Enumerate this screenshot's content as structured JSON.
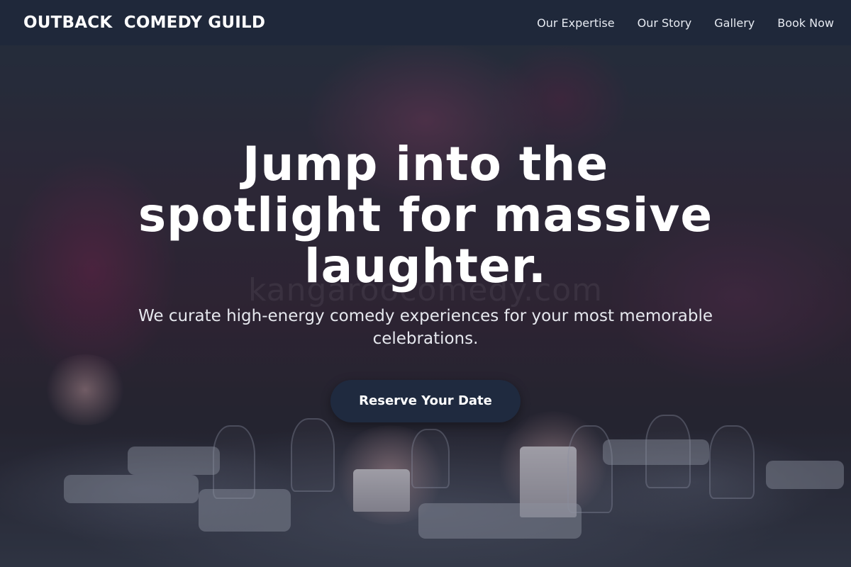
{
  "header": {
    "brand": "OUTBACK  COMEDY GUILD",
    "nav": [
      {
        "label": "Our Expertise"
      },
      {
        "label": "Our Story"
      },
      {
        "label": "Gallery"
      },
      {
        "label": "Book Now"
      }
    ]
  },
  "hero": {
    "headline": "Jump into the spotlight for massive laughter.",
    "subtitle": "We curate high-energy comedy experiences for your most memorable celebrations.",
    "cta_label": "Reserve Your Date",
    "watermark": "kangaroocomedy.com"
  },
  "colors": {
    "header_bg": "#1f293a",
    "cta_bg": "#1f2a3f",
    "text": "#ffffff"
  }
}
